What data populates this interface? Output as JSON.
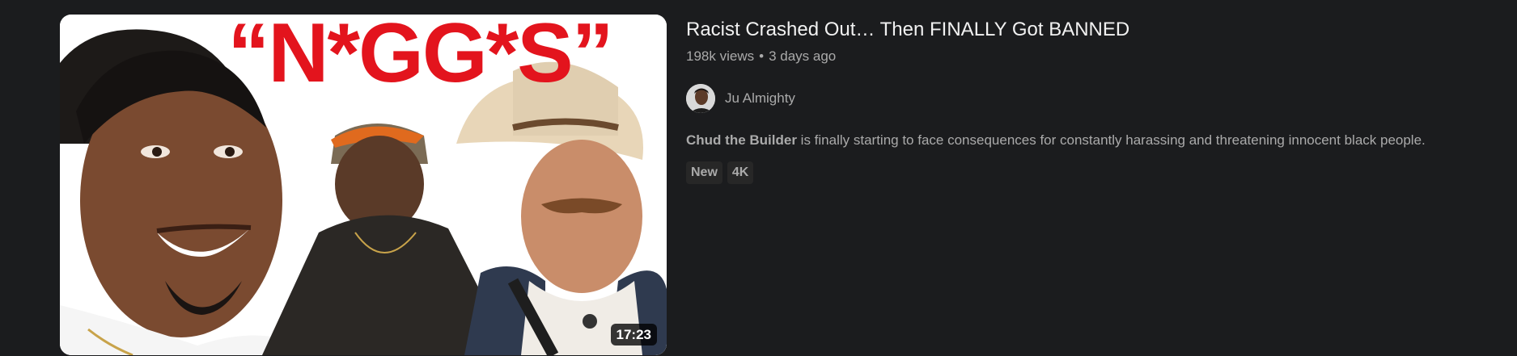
{
  "thumbnail": {
    "overlay_text": "“N*GG*S”",
    "duration": "17:23"
  },
  "video": {
    "title": "Racist Crashed Out… Then FINALLY Got BANNED",
    "views": "198k views",
    "separator": "•",
    "age": "3 days ago"
  },
  "channel": {
    "name": "Ju Almighty"
  },
  "description": {
    "bold": "Chud the Builder",
    "rest": " is finally starting to face consequences for constantly harassing and threatening innocent black people."
  },
  "badges": [
    "New",
    "4K"
  ],
  "colors": {
    "background": "#1b1c1e",
    "title": "#f1f1f1",
    "secondary_text": "#aaaaaa",
    "badge_bg": "#272727",
    "thumb_text_red": "#e3141d"
  }
}
